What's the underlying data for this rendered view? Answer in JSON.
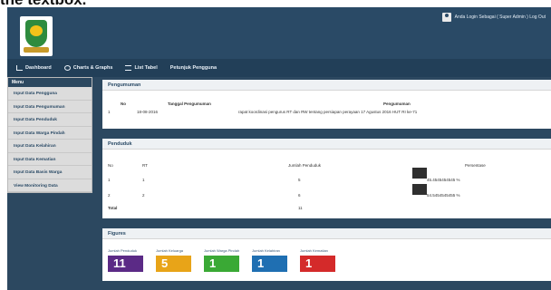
{
  "caption": "the textbox.",
  "header": {
    "user_text": "Anda Login Sebagai ( Super Admin ) Log Out"
  },
  "nav": {
    "items": [
      "Dashboard",
      "Charts & Graphs",
      "List Tabel",
      "Petunjuk Pengguna"
    ]
  },
  "sidebar": {
    "title": "Menu",
    "items": [
      "Input Data Pengguna",
      "Input Data Pengumuman",
      "Input Data Penduduk",
      "Input Data Warga Pindah",
      "Input Data Kelahiran",
      "Input Data Kematian",
      "Input Data Basis Warga",
      "View Monitoring Data"
    ]
  },
  "pengumuman": {
    "title": "Pengumuman",
    "col_no": "No",
    "col_tanggal": "Tanggal Pengumuman",
    "col_isi": "Pengumuman",
    "row": {
      "no": "1",
      "tanggal": "18-08-2016",
      "isi": "rapat koordinasi pengurus RT dan RW tentang persiapan perayaan 17 Agustus 2016 HUT RI ke-71"
    }
  },
  "penduduk": {
    "title": "Penduduk",
    "col_no": "No",
    "col_rt": "RT",
    "col_jumlah": "Jumlah Penduduk",
    "col_persen": "Persentase",
    "rows": [
      {
        "no": "1",
        "rt": "1",
        "jumlah": "5",
        "persen": "45.4545454545 %"
      },
      {
        "no": "2",
        "rt": "2",
        "jumlah": "6",
        "persen": "54.5454545455 %"
      }
    ],
    "total_label": "Total",
    "total_value": "11"
  },
  "figures": {
    "title": "Figures",
    "tiles": [
      {
        "label": "Jumlah Penduduk",
        "value": "11",
        "color": "#5b2a86"
      },
      {
        "label": "Jumlah Keluarga",
        "value": "5",
        "color": "#e8a418"
      },
      {
        "label": "Jumlah Warga Pindah",
        "value": "1",
        "color": "#3aa935"
      },
      {
        "label": "Jumlah Kelahiran",
        "value": "1",
        "color": "#1f6fb2"
      },
      {
        "label": "Jumlah Kematian",
        "value": "1",
        "color": "#d42a2a"
      }
    ]
  }
}
